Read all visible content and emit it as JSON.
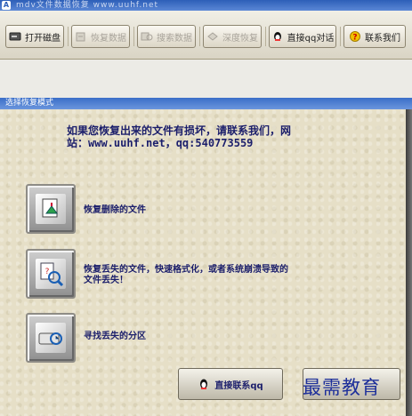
{
  "window": {
    "title": "mdv文件数据恢复 www.uuhf.net"
  },
  "toolbar": {
    "open_disk": "打开磁盘",
    "recover_data": "恢复数据",
    "search_data": "搜索数据",
    "deep_recover": "深度恢复",
    "qq_chat": "直接qq对话",
    "contact_us": "联系我们"
  },
  "panel": {
    "title": "选择恢复模式",
    "notice_line1": "如果您恢复出来的文件有损坏，请联系我们，网",
    "notice_line2": "站：www.uuhf.net，qq:540773559",
    "options": [
      {
        "label_line1": "恢复删除的文件",
        "label_line2": "",
        "icon": "recycle-icon"
      },
      {
        "label_line1": "恢复丢失的文件，快速格式化，或者系统崩溃导致的",
        "label_line2": "文件丢失！",
        "icon": "search-file-icon"
      },
      {
        "label_line1": "寻找丢失的分区",
        "label_line2": "",
        "icon": "disk-icon"
      }
    ],
    "contact_qq_button": "直接联系qq"
  },
  "watermark": "最需教育",
  "colors": {
    "titlebar": "#3a6ec8",
    "text_blue": "#1b1e6b",
    "panel_bg": "#e6dfc7"
  }
}
